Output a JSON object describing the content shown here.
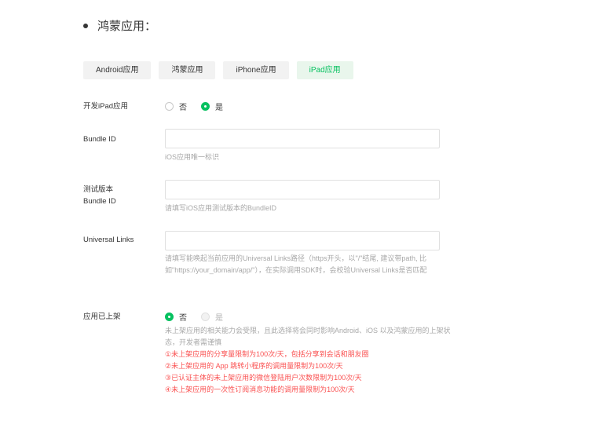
{
  "section": {
    "title": "鸿蒙应用："
  },
  "tabs": [
    {
      "label": "Android应用",
      "active": false
    },
    {
      "label": "鸿蒙应用",
      "active": false
    },
    {
      "label": "iPhone应用",
      "active": false
    },
    {
      "label": "iPad应用",
      "active": true
    }
  ],
  "colors": {
    "accent": "#07c160",
    "warning": "#fa5151",
    "hint": "#a8a8a8"
  },
  "form": {
    "develop_ipad": {
      "label": "开发iPad应用",
      "options": [
        {
          "label": "否",
          "checked": false
        },
        {
          "label": "是",
          "checked": true
        }
      ]
    },
    "bundle_id": {
      "label": "Bundle ID",
      "value": "",
      "hint": "iOS应用唯一标识"
    },
    "test_bundle_id": {
      "label_line1": "测试版本",
      "label_line2": "Bundle ID",
      "value": "",
      "hint": "请填写iOS应用测试版本的BundleID"
    },
    "universal_links": {
      "label": "Universal Links",
      "value": "",
      "hint": "请填写能唤起当前应用的Universal Links路径（https开头，以\"/\"结尾, 建议带path, 比如\"https://your_domain/app/\"），在实际调用SDK时，会校验Universal Links是否匹配"
    },
    "listed": {
      "label": "应用已上架",
      "options": [
        {
          "label": "否",
          "checked": true
        },
        {
          "label": "是",
          "checked": false,
          "disabled": true
        }
      ],
      "note": "未上架应用的相关能力会受限，且此选择将会同时影响Android、iOS 以及鸿蒙应用的上架状态，开发者需谨慎",
      "warnings": [
        "①未上架应用的分享量限制为100次/天，包括分享到会话和朋友圈",
        "②未上架应用的 App 跳转小程序的调用量限制为100次/天",
        "③已认证主体的未上架应用的微信登陆用户次数限制为100次/天",
        "④未上架应用的一次性订阅消息功能的调用量限制为100次/天"
      ]
    }
  }
}
